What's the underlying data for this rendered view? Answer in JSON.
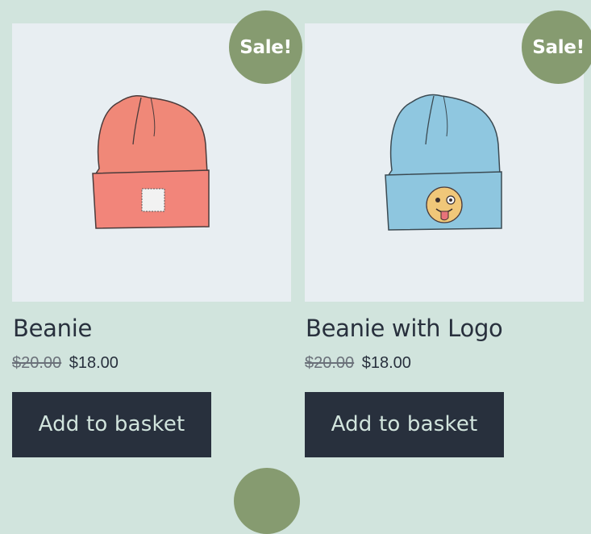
{
  "products": [
    {
      "name": "Beanie",
      "badge": "Sale!",
      "old_price": "$20.00",
      "price": "$18.00",
      "button": "Add to basket",
      "colors": {
        "hat": "#f08878",
        "cuff": "#f2857a"
      },
      "image_icon": "beanie-icon"
    },
    {
      "name": "Beanie with Logo",
      "badge": "Sale!",
      "old_price": "$20.00",
      "price": "$18.00",
      "button": "Add to basket",
      "colors": {
        "hat": "#8fc7e0",
        "cuff": "#8ec6df"
      },
      "image_icon": "beanie-logo-icon"
    }
  ],
  "theme": {
    "background": "#d1e4dd",
    "sale_badge": "#869b70",
    "button": "#28303d"
  }
}
